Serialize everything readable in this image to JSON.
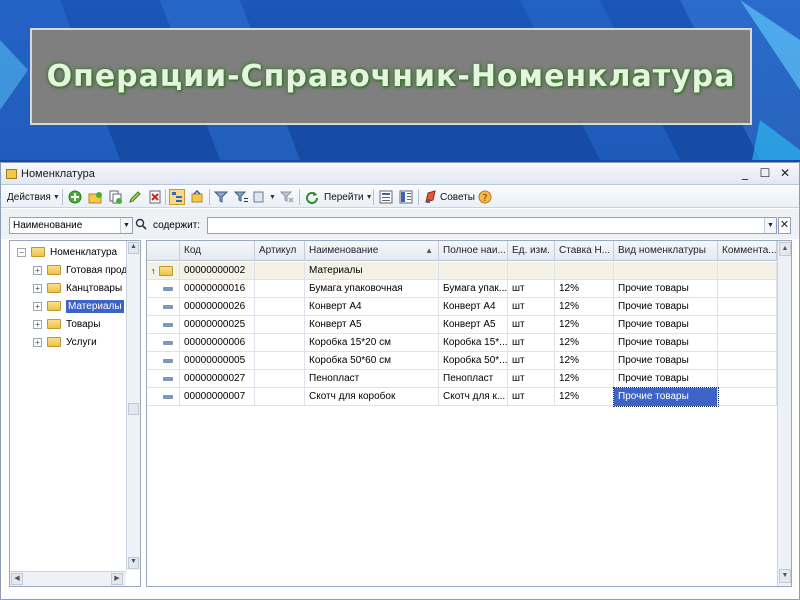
{
  "slide": {
    "title": "Операции-Справочник-Номенклатура"
  },
  "window": {
    "title": "Номенклатура",
    "buttons": {
      "minimize": "_",
      "maximize": "☐",
      "close": "✕"
    }
  },
  "toolbar": {
    "actions_label": "Действия",
    "goto_label": "Перейти",
    "tips_label": "Советы",
    "icons": [
      "add-icon",
      "add-group-icon",
      "copy-icon",
      "edit-icon",
      "delete-icon",
      "tree-mode-icon",
      "hierarchy-icon",
      "filter-icon",
      "filter-list-icon",
      "sort-icon",
      "clear-filter-icon",
      "refresh-icon",
      "list-icon",
      "columns-icon",
      "tips-icon",
      "help-icon"
    ]
  },
  "filter": {
    "field_value": "Наименование",
    "contains_label": "содержит:",
    "contains_value": ""
  },
  "tree": {
    "root": "Номенклатура",
    "items": [
      {
        "label": "Готовая прод"
      },
      {
        "label": "Канцтовары"
      },
      {
        "label": "Материалы",
        "selected": true
      },
      {
        "label": "Товары"
      },
      {
        "label": "Услуги"
      }
    ]
  },
  "grid": {
    "columns": [
      "Код",
      "Артикул",
      "Наименование",
      "Полное наи...",
      "Ед. изм.",
      "Ставка Н...",
      "Вид номенклатуры",
      "Коммента..."
    ],
    "group_row": {
      "code": "00000000002",
      "name": "Материалы"
    },
    "rows": [
      {
        "code": "00000000016",
        "article": "",
        "name": "Бумага упаковочная",
        "full": "Бумага упак...",
        "unit": "шт",
        "vat": "12%",
        "kind": "Прочие товары",
        "comment": ""
      },
      {
        "code": "00000000026",
        "article": "",
        "name": "Конверт А4",
        "full": "Конверт А4",
        "unit": "шт",
        "vat": "12%",
        "kind": "Прочие товары",
        "comment": ""
      },
      {
        "code": "00000000025",
        "article": "",
        "name": "Конверт А5",
        "full": "Конверт А5",
        "unit": "шт",
        "vat": "12%",
        "kind": "Прочие товары",
        "comment": ""
      },
      {
        "code": "00000000006",
        "article": "",
        "name": "Коробка 15*20 см",
        "full": "Коробка 15*...",
        "unit": "шт",
        "vat": "12%",
        "kind": "Прочие товары",
        "comment": ""
      },
      {
        "code": "00000000005",
        "article": "",
        "name": "Коробка 50*60 см",
        "full": "Коробка 50*...",
        "unit": "шт",
        "vat": "12%",
        "kind": "Прочие товары",
        "comment": ""
      },
      {
        "code": "00000000027",
        "article": "",
        "name": "Пенопласт",
        "full": "Пенопласт",
        "unit": "шт",
        "vat": "12%",
        "kind": "Прочие товары",
        "comment": ""
      },
      {
        "code": "00000000007",
        "article": "",
        "name": "Скотч для коробок",
        "full": "Скотч для к...",
        "unit": "шт",
        "vat": "12%",
        "kind": "Прочие товары",
        "comment": ""
      }
    ]
  }
}
